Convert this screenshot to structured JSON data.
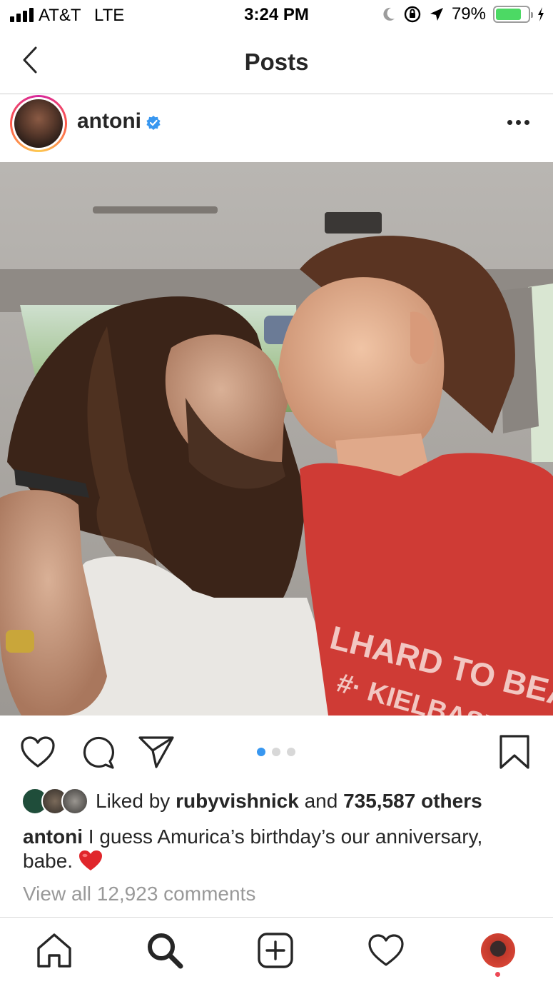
{
  "status_bar": {
    "carrier": "AT&T",
    "network": "LTE",
    "time": "3:24 PM",
    "battery_percent": "79%",
    "battery_level": 0.79
  },
  "nav": {
    "title": "Posts"
  },
  "post": {
    "username": "antoni",
    "verified": true,
    "shirt_text_line1": "LHARD TO BEAT",
    "shirt_text_line2": "#· KIELBASY",
    "carousel": {
      "total": 3,
      "active": 1
    },
    "likes": {
      "prefix": "Liked by",
      "first_user": "rubyvishnick",
      "joiner": "and",
      "others": "735,587 others"
    },
    "caption": {
      "author": "antoni",
      "text": "I guess Amurica’s birthday’s our anniversary, babe."
    },
    "view_comments": "View all 12,923 comments"
  },
  "icons": {
    "status": [
      "signal-icon",
      "moon-icon",
      "orientation-lock-icon",
      "location-icon",
      "battery-icon",
      "charging-icon"
    ],
    "actions": [
      "heart-icon",
      "comment-icon",
      "share-icon",
      "bookmark-icon"
    ],
    "tabs": [
      "home-icon",
      "search-icon",
      "add-post-icon",
      "activity-heart-icon",
      "profile-avatar"
    ]
  },
  "colors": {
    "accent_blue": "#3897f0",
    "battery_green": "#4cd964",
    "notification_red": "#ed4956",
    "muted_text": "#999999"
  }
}
